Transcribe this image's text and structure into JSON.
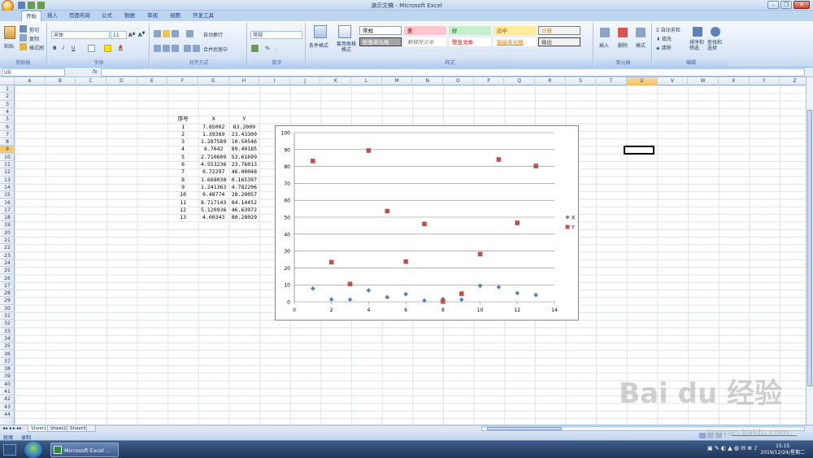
{
  "window": {
    "title": "演示文稿 - Microsoft Excel"
  },
  "tabs": [
    "开始",
    "插入",
    "页面布局",
    "公式",
    "数据",
    "审阅",
    "视图",
    "开发工具"
  ],
  "ribbon": {
    "clipboard": {
      "paste": "粘贴",
      "cut": "剪切",
      "copy": "复制",
      "format_painter": "格式刷",
      "label": "剪贴板"
    },
    "font": {
      "name": "宋体",
      "size": "11",
      "label": "字体",
      "bold": "B",
      "italic": "I",
      "underline": "U",
      "font_color": "A"
    },
    "alignment": {
      "wrap": "自动换行",
      "merge": "合并后居中",
      "label": "对齐方式"
    },
    "number": {
      "format": "常规",
      "percent": "%",
      "comma": ",",
      "label": "数字"
    },
    "styles": {
      "conditional": "条件格式",
      "table_format": "套用表格格式",
      "label": "样式",
      "cells": [
        {
          "text": "常规",
          "bg": "#ffffff",
          "fg": "#000000",
          "border": "#9aa0a6"
        },
        {
          "text": "差",
          "bg": "#ffc7ce",
          "fg": "#9c0006",
          "border": "#ffc7ce"
        },
        {
          "text": "好",
          "bg": "#c6efce",
          "fg": "#006100",
          "border": "#c6efce"
        },
        {
          "text": "适中",
          "bg": "#ffeb9c",
          "fg": "#9c5700",
          "border": "#ffeb9c"
        },
        {
          "text": "计算",
          "bg": "#f2f2f2",
          "fg": "#fa7d00",
          "border": "#7f7f7f"
        },
        {
          "text": "检查单元格",
          "bg": "#a5a5a5",
          "fg": "#ffffff",
          "border": "#3f3f3f"
        },
        {
          "text": "解释性文本",
          "bg": "#ffffff",
          "fg": "#7f7f7f",
          "border": "#ffffff"
        },
        {
          "text": "警告文本",
          "bg": "#ffffff",
          "fg": "#ff0000",
          "border": "#ffffff"
        },
        {
          "text": "链接单元格",
          "bg": "#ffffff",
          "fg": "#fa7d00",
          "border": "#ffffff"
        },
        {
          "text": "输出",
          "bg": "#f2f2f2",
          "fg": "#3f3f3f",
          "border": "#3f3f3f"
        }
      ]
    },
    "cells": {
      "insert": "插入",
      "delete": "删除",
      "format": "格式",
      "label": "单元格"
    },
    "editing": {
      "autosum": "自动求和",
      "fill": "填充",
      "clear": "清除",
      "sort": "排序和筛选",
      "find": "查找和选择",
      "label": "编辑"
    }
  },
  "formula_bar": {
    "name_box": "U9",
    "fx": "fx",
    "formula": ""
  },
  "columns": [
    "A",
    "B",
    "C",
    "D",
    "E",
    "F",
    "G",
    "H",
    "I",
    "J",
    "K",
    "L",
    "M",
    "N",
    "O",
    "P",
    "Q",
    "R",
    "S",
    "T",
    "U",
    "V",
    "W",
    "X",
    "Y",
    "Z"
  ],
  "selected_column": "U",
  "selected_row": "9",
  "rows": [
    "1",
    "2",
    "3",
    "4",
    "5",
    "6",
    "7",
    "8",
    "9",
    "10",
    "11",
    "12",
    "13",
    "14",
    "15",
    "16",
    "17",
    "18",
    "19",
    "20",
    "21",
    "22",
    "23",
    "24",
    "25",
    "26",
    "27",
    "28",
    "29",
    "30",
    "31",
    "32",
    "33",
    "34",
    "35",
    "36",
    "37",
    "38",
    "39",
    "40",
    "41",
    "42",
    "43",
    "44"
  ],
  "table": {
    "headers": [
      "序号",
      "X",
      "Y"
    ],
    "rows": [
      [
        "1",
        "7.85002",
        "83.2009"
      ],
      [
        "2",
        "1.39389",
        "23.43309"
      ],
      [
        "3",
        "1.287589",
        "10.50546"
      ],
      [
        "4",
        "6.7642",
        "89.40185"
      ],
      [
        "5",
        "2.710609",
        "53.61699"
      ],
      [
        "6",
        "4.553236",
        "23.76013"
      ],
      [
        "7",
        "0.72297",
        "46.00048"
      ],
      [
        "8",
        "1.668038",
        "0.165397"
      ],
      [
        "9",
        "1.241363",
        "4.782206"
      ],
      [
        "10",
        "9.48774",
        "28.20057"
      ],
      [
        "11",
        "8.717143",
        "84.14452"
      ],
      [
        "12",
        "5.120936",
        "46.63972"
      ],
      [
        "13",
        "4.00343",
        "80.28029"
      ]
    ]
  },
  "chart_data": {
    "type": "scatter",
    "x": [
      1,
      2,
      3,
      4,
      5,
      6,
      7,
      8,
      9,
      10,
      11,
      12,
      13
    ],
    "series": [
      {
        "name": "X",
        "color": "#4f81bd",
        "marker": "diamond",
        "values": [
          7.85002,
          1.39389,
          1.287589,
          6.7642,
          2.710609,
          4.553236,
          0.72297,
          1.668038,
          1.241363,
          9.48774,
          8.717143,
          5.120936,
          4.00343
        ]
      },
      {
        "name": "Y",
        "color": "#c0504d",
        "marker": "square",
        "values": [
          83.2009,
          23.43309,
          10.50546,
          89.40185,
          53.61699,
          23.76013,
          46.00048,
          0.165397,
          4.782206,
          28.20057,
          84.14452,
          46.63972,
          80.28029
        ]
      }
    ],
    "xlim": [
      0,
      14
    ],
    "ylim": [
      0,
      100
    ],
    "xticks": [
      "0",
      "2",
      "4",
      "6",
      "8",
      "10",
      "12",
      "14"
    ],
    "yticks": [
      "0",
      "10",
      "20",
      "30",
      "40",
      "50",
      "60",
      "70",
      "80",
      "90",
      "100"
    ],
    "grid": "horizontal",
    "legend": "right"
  },
  "sheets": [
    "Sheet1",
    "Sheet2",
    "Sheet3"
  ],
  "status": {
    "ready": "就绪",
    "record": "录制"
  },
  "taskbar": {
    "app": "Microsoft Excel ...",
    "time": "15:15",
    "date": "2019/12/24/星期二"
  },
  "watermark": {
    "brand": "Bai du 经验",
    "url": "jingyan.baidu.com"
  }
}
